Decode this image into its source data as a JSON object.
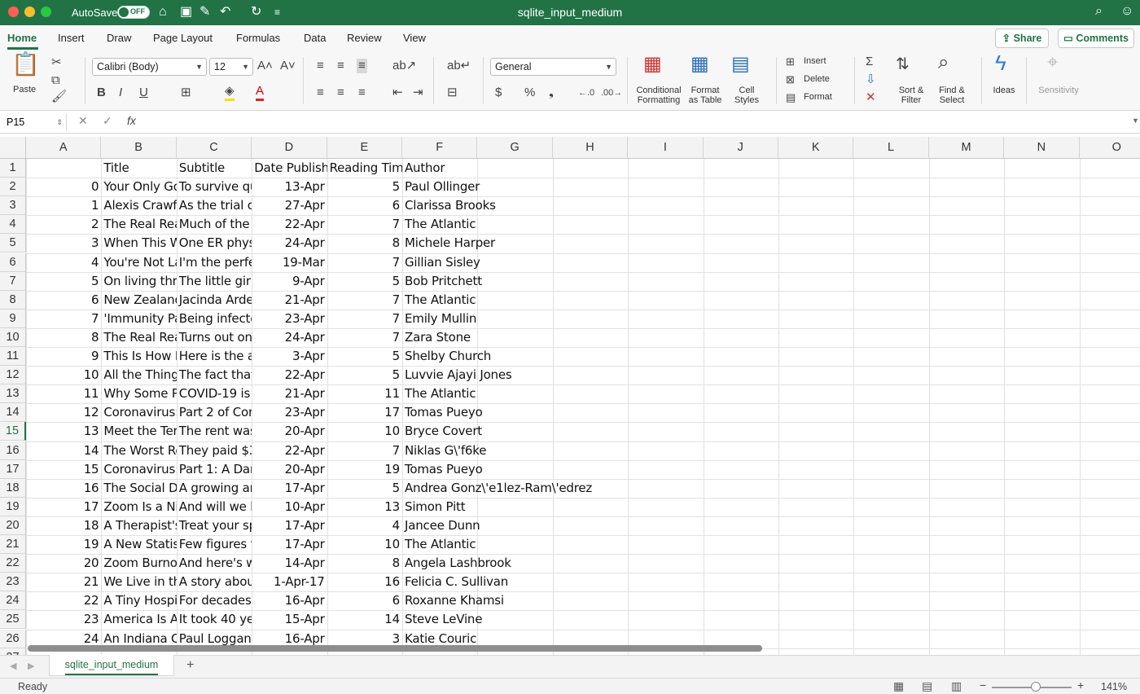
{
  "titlebar": {
    "autosave_label": "AutoSave",
    "autosave_state": "OFF",
    "title": "sqlite_input_medium"
  },
  "tabs": [
    "Home",
    "Insert",
    "Draw",
    "Page Layout",
    "Formulas",
    "Data",
    "Review",
    "View"
  ],
  "share_label": "Share",
  "comments_label": "Comments",
  "ribbon": {
    "paste": "Paste",
    "font_name": "Calibri (Body)",
    "font_size": "12",
    "number_format": "General",
    "conditional_formatting": [
      "Conditional",
      "Formatting"
    ],
    "format_as_table": [
      "Format",
      "as Table"
    ],
    "cell_styles": [
      "Cell",
      "Styles"
    ],
    "insert": "Insert",
    "delete": "Delete",
    "format": "Format",
    "sort_filter": [
      "Sort &",
      "Filter"
    ],
    "find_select": [
      "Find &",
      "Select"
    ],
    "ideas": "Ideas",
    "sensitivity": "Sensitivity"
  },
  "formula_bar": {
    "name_box": "P15",
    "fx": "fx",
    "content": ""
  },
  "columns": [
    "A",
    "B",
    "C",
    "D",
    "E",
    "F",
    "G",
    "H",
    "I",
    "J",
    "K",
    "L",
    "M",
    "N",
    "O"
  ],
  "selected_row": 15,
  "header_row": [
    "",
    "Title",
    "Subtitle",
    "Date Publish",
    "Reading Time",
    "Author"
  ],
  "rows": [
    [
      "0",
      "Your Only Go",
      "To survive qu",
      "13-Apr",
      "5",
      "Paul Ollinger"
    ],
    [
      "1",
      "Alexis Crawfo",
      "As the trial c",
      "27-Apr",
      "6",
      "Clarissa Brooks"
    ],
    [
      "2",
      "The Real Rea",
      "Much of the",
      "22-Apr",
      "7",
      "The Atlantic"
    ],
    [
      "3",
      "When This W",
      "One ER physi",
      "24-Apr",
      "8",
      "Michele Harper"
    ],
    [
      "4",
      "You're Not La",
      "I'm the perfe",
      "19-Mar",
      "7",
      "Gillian Sisley"
    ],
    [
      "5",
      "On living thro",
      "The little girl",
      "9-Apr",
      "5",
      "Bob Pritchett"
    ],
    [
      "6",
      "New Zealand",
      "Jacinda Arde",
      "21-Apr",
      "7",
      "The Atlantic"
    ],
    [
      "7",
      "'Immunity Pa",
      "Being infecte",
      "23-Apr",
      "7",
      "Emily Mullin"
    ],
    [
      "8",
      "The Real Rea",
      "Turns out on",
      "24-Apr",
      "7",
      "Zara Stone"
    ],
    [
      "9",
      "This Is How M",
      "Here is the a",
      "3-Apr",
      "5",
      "Shelby Church"
    ],
    [
      "10",
      "All the Thing",
      "The fact that",
      "22-Apr",
      "5",
      "Luvvie Ajayi Jones"
    ],
    [
      "11",
      "Why Some P",
      "COVID-19 is p",
      "21-Apr",
      "11",
      "The Atlantic"
    ],
    [
      "12",
      "Coronavirus:",
      "Part 2 of Cor",
      "23-Apr",
      "17",
      "Tomas Pueyo"
    ],
    [
      "13",
      "Meet the Ter",
      "The rent was",
      "20-Apr",
      "10",
      "Bryce Covert"
    ],
    [
      "14",
      "The Worst Re",
      "They paid $3",
      "22-Apr",
      "7",
      "Niklas G\\'f6ke"
    ],
    [
      "15",
      "Coronavirus:",
      "Part 1: A Dar",
      "20-Apr",
      "19",
      "Tomas Pueyo"
    ],
    [
      "16",
      "The Social Di",
      "A growing ar",
      "17-Apr",
      "5",
      "Andrea Gonz\\'e1lez-Ram\\'edrez"
    ],
    [
      "17",
      "Zoom Is a Nig",
      "And will we k",
      "10-Apr",
      "13",
      "Simon Pitt"
    ],
    [
      "18",
      "A Therapist's",
      "Treat your sp",
      "17-Apr",
      "4",
      "Jancee Dunn"
    ],
    [
      "19",
      "A New Statis",
      "Few figures t",
      "17-Apr",
      "10",
      "The Atlantic"
    ],
    [
      "20",
      "Zoom Burnou",
      "And here's w",
      "14-Apr",
      "8",
      "Angela Lashbrook"
    ],
    [
      "21",
      "We Live in th",
      "A story abou",
      "1-Apr-17",
      "16",
      "Felicia C. Sullivan"
    ],
    [
      "22",
      "A Tiny Hospi",
      "For decades",
      "16-Apr",
      "6",
      "Roxanne Khamsi"
    ],
    [
      "23",
      "America Is Al",
      "It took 40 ye",
      "15-Apr",
      "14",
      "Steve LeVine"
    ],
    [
      "24",
      "An Indiana C",
      "Paul Loggan",
      "16-Apr",
      "3",
      "Katie Couric"
    ]
  ],
  "sheet_tab": "sqlite_input_medium",
  "status": {
    "ready": "Ready",
    "zoom": "141%"
  }
}
